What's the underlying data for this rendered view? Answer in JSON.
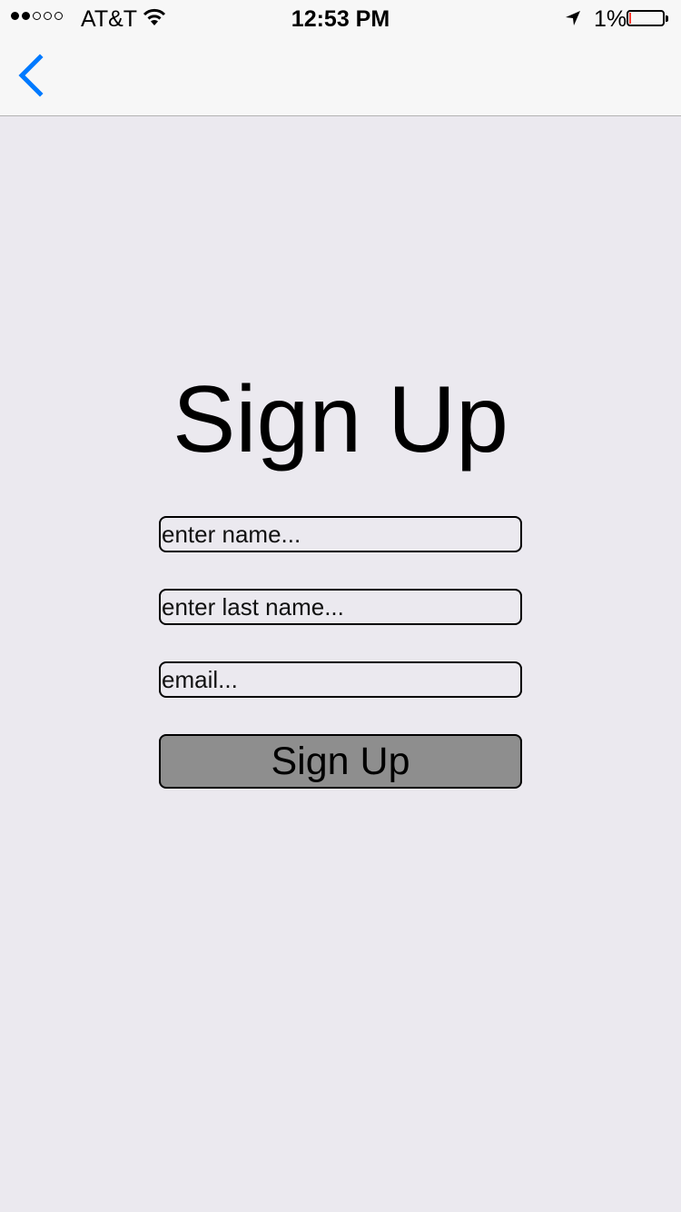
{
  "status_bar": {
    "signal_filled": 2,
    "signal_total": 5,
    "carrier": "AT&T",
    "time": "12:53 PM",
    "battery_percent": "1%",
    "battery_level": 0.01,
    "icons": [
      "wifi-icon",
      "location-arrow-icon",
      "battery-icon"
    ]
  },
  "nav_bar": {
    "back_icon": "chevron-left-icon",
    "accent_color": "#007aff"
  },
  "form": {
    "title": "Sign Up",
    "name_placeholder": "enter name...",
    "last_name_placeholder": "enter last name...",
    "email_placeholder": "email...",
    "submit_label": "Sign Up"
  },
  "colors": {
    "background": "#ebe9ef",
    "button_fill": "#8e8e8e",
    "battery_low": "#ff3b30"
  }
}
